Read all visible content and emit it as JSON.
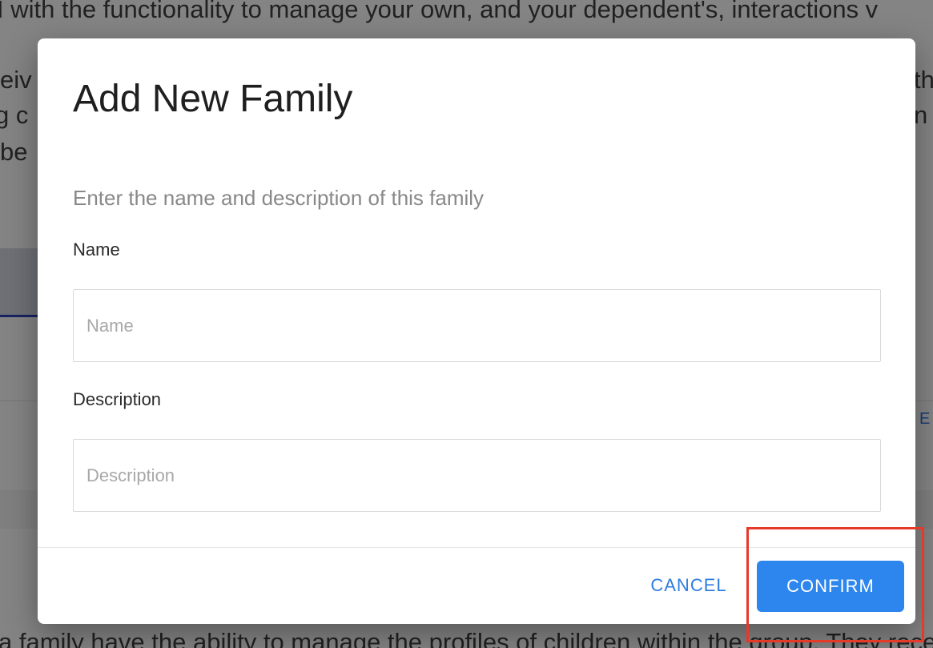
{
  "background": {
    "lines": [
      "I with the functionality to manage your own, and your dependent's, interactions v",
      "eiv",
      "th",
      "g c",
      "n a",
      "be",
      "a family have the ability to manage the profiles of children within the group. They receiv"
    ],
    "right_link_fragment": "E"
  },
  "dialog": {
    "title": "Add New Family",
    "subtitle": "Enter the name and description of this family",
    "fields": [
      {
        "label": "Name",
        "placeholder": "Name",
        "value": ""
      },
      {
        "label": "Description",
        "placeholder": "Description",
        "value": ""
      }
    ],
    "cancel_label": "CANCEL",
    "confirm_label": "CONFIRM"
  },
  "colors": {
    "primary": "#2c86ee",
    "highlight": "#e5392a"
  }
}
